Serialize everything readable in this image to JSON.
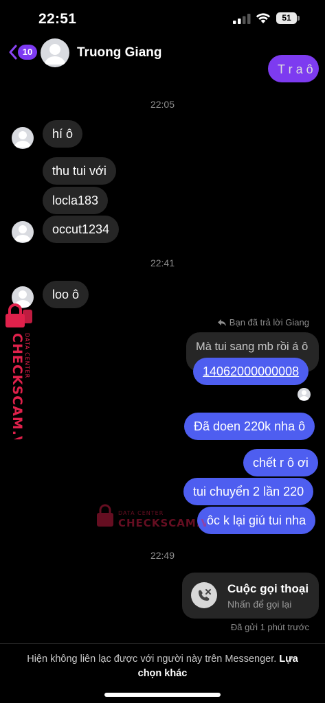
{
  "status_bar": {
    "time": "22:51",
    "battery": "51"
  },
  "header": {
    "back_count": "10",
    "contact_name": "Truong Giang"
  },
  "messages": {
    "cutoff_text": "T r a ô",
    "time_1": "22:05",
    "m1": "hí ô",
    "m2": "thu tui với",
    "m3": "locla183",
    "m4": "occut1234",
    "time_2": "22:41",
    "m5": "loo ô",
    "reply_note": "Bạn đã trả lời Giang",
    "quoted": "Mà tui sang mb rồi á ô",
    "m6": "14062000000008",
    "m7": "Đã doen 220k nha ô",
    "m8": "chết r ô ơi",
    "m9": "tui chuyển 2 lần 220",
    "m10": "ôc k lại giú tui nha",
    "time_3": "22:49"
  },
  "call": {
    "title": "Cuộc gọi thoại",
    "subtitle": "Nhấn để gọi lại",
    "status": "Đã gửi 1 phút trước"
  },
  "footer": {
    "notice": "Hiện không liên lạc được với người này trên Messenger.",
    "link": "Lựa chọn khác"
  },
  "watermark": {
    "brand": "CHECKSCAM.VN",
    "tag": "DATA CENTER"
  },
  "colors": {
    "outgoing": "#4e5ef0",
    "outgoing_top": "#7d3bf0",
    "incoming": "#262626",
    "badge": "#7d3af2",
    "watermark": "#e0214b"
  }
}
